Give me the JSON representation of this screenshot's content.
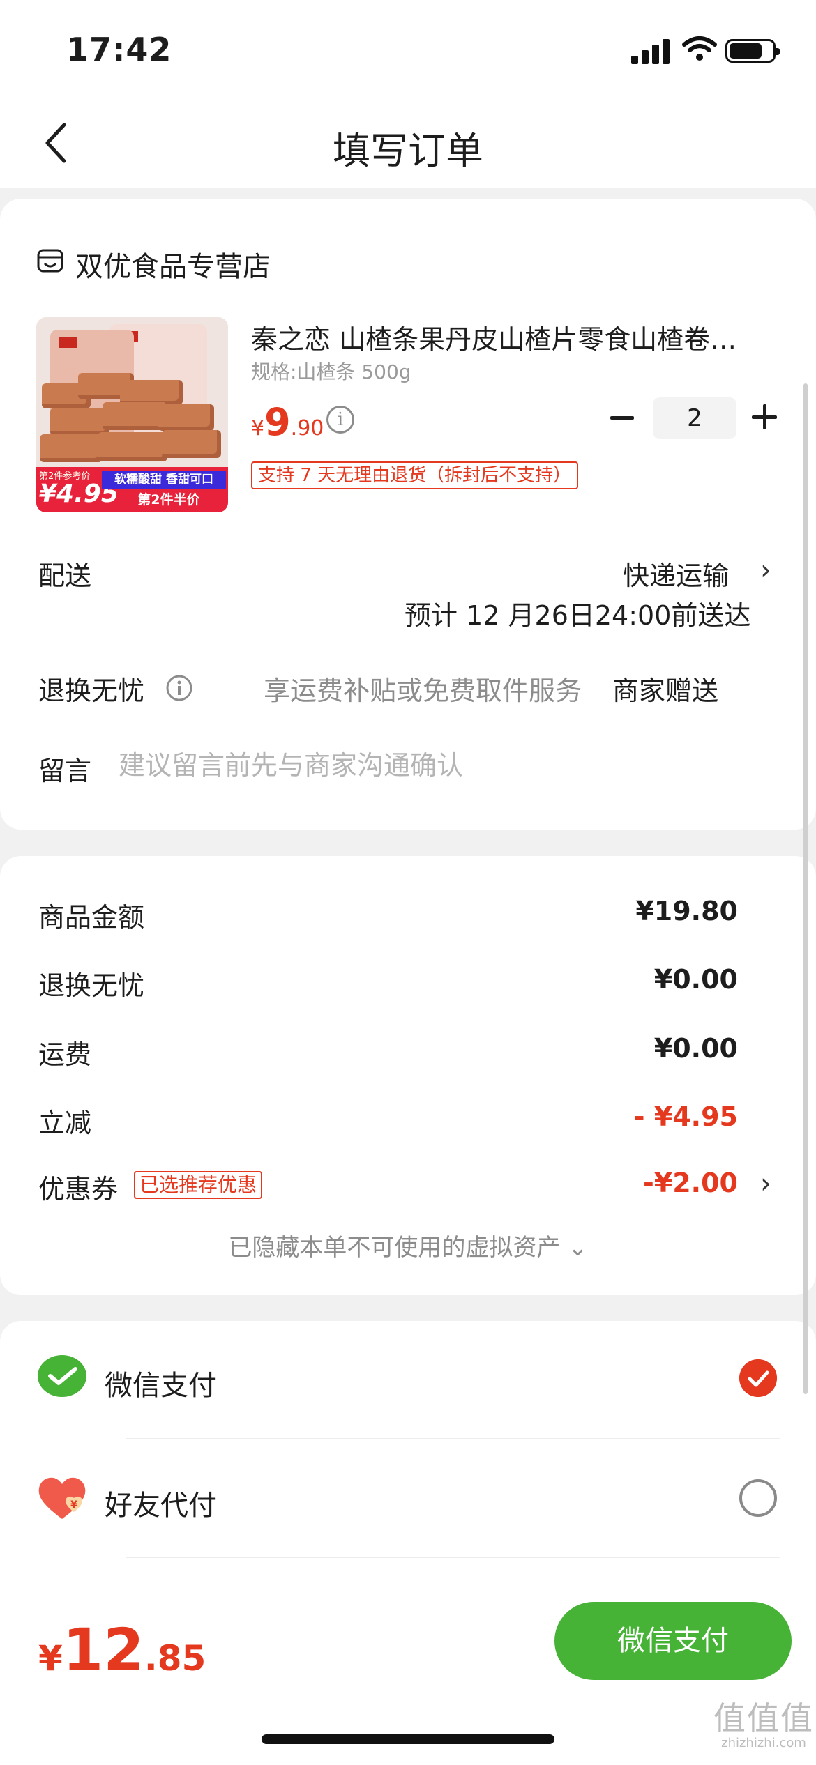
{
  "status_bar": {
    "time": "17:42"
  },
  "nav": {
    "title": "填写订单"
  },
  "store": {
    "name": "双优食品专营店"
  },
  "product": {
    "title": "秦之恋 山楂条果丹皮山楂片零食山楂卷…",
    "spec": "规格:山楂条 500g",
    "price_symbol": "¥",
    "price_int": "9",
    "price_dec": ".90",
    "quantity": "2",
    "return_policy": "支持 7 天无理由退货（拆封后不支持）",
    "image_badge": {
      "ref_label": "第2件参考价",
      "ref_price": "¥4.95",
      "tag1": "软糯酸甜 香甜可口",
      "tag2": "第2件半价"
    }
  },
  "delivery": {
    "label": "配送",
    "method": "快递运输",
    "eta": "预计 12 月26日24:00前送达"
  },
  "worry_free": {
    "label": "退换无忧",
    "desc": "享运费补贴或免费取件服务",
    "gift": "商家赠送"
  },
  "message": {
    "label": "留言",
    "placeholder": "建议留言前先与商家沟通确认"
  },
  "summary": {
    "rows": [
      {
        "label": "商品金额",
        "value": "¥19.80"
      },
      {
        "label": "退换无忧",
        "value": "¥0.00"
      },
      {
        "label": "运费",
        "value": "¥0.00"
      },
      {
        "label": "立减",
        "value": "- ¥4.95"
      },
      {
        "label": "优惠券",
        "value": "-¥2.00"
      }
    ],
    "coupon_tag": "已选推荐优惠",
    "hidden_assets": "已隐藏本单不可使用的虚拟资产 ⌄"
  },
  "payment": {
    "options": [
      {
        "label": "微信支付",
        "selected": true
      },
      {
        "label": "好友代付",
        "selected": false
      }
    ],
    "friend_icon_symbol": "¥"
  },
  "footer": {
    "total_symbol": "¥",
    "total_int": "12",
    "total_dec": ".85",
    "pay_button": "微信支付"
  },
  "watermark": {
    "glyphs": "值值值",
    "site": "zhizhizhi.com"
  },
  "colors": {
    "accent_red": "#e4391f",
    "wechat_green": "#46b336"
  }
}
